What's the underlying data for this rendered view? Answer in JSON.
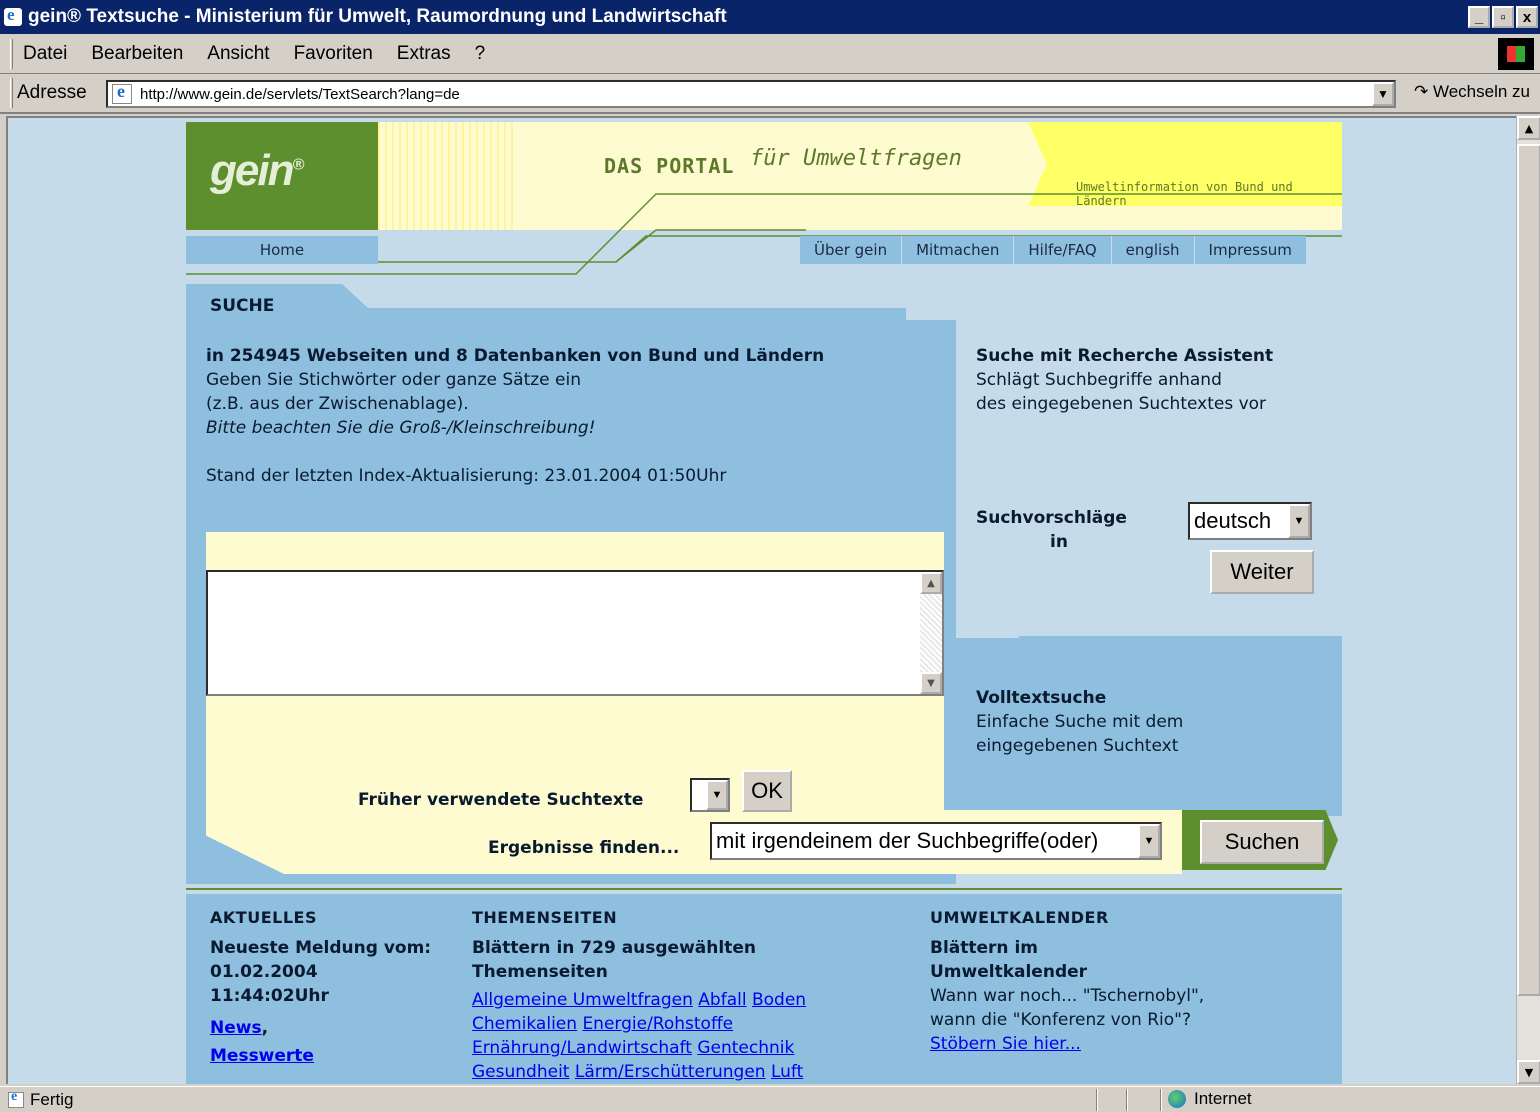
{
  "window": {
    "title": "gein® Textsuche - Ministerium für Umwelt, Raumordnung und Landwirtschaft",
    "controls": [
      "_",
      "▫",
      "x"
    ]
  },
  "menu": [
    "Datei",
    "Bearbeiten",
    "Ansicht",
    "Favoriten",
    "Extras",
    "?"
  ],
  "address": {
    "label": "Adresse",
    "url": "http://www.gein.de/servlets/TextSearch?lang=de",
    "go": "Wechseln zu"
  },
  "header": {
    "logo": "gein",
    "portal": "DAS PORTAL",
    "tagline": "für Umweltfragen",
    "info": "Umweltinformation von Bund und Ländern"
  },
  "nav": {
    "home": "Home",
    "items": [
      "Über gein",
      "Mitmachen",
      "Hilfe/FAQ",
      "english",
      "Impressum"
    ]
  },
  "search": {
    "section": "SUCHE",
    "headline": "in 254945 Webseiten und 8 Datenbanken von Bund und Ländern",
    "line1": "Geben Sie Stichwörter oder ganze Sätze ein",
    "line2": "(z.B. aus der Zwischenablage).",
    "note": "Bitte beachten Sie die Groß-/Kleinschreibung!",
    "index": "Stand der letzten Index-Aktualisierung: 23.01.2004 01:50Uhr",
    "textarea_value": "",
    "history_label": "Früher verwendete Suchtexte",
    "history_value": "",
    "ok": "OK",
    "results_label": "Ergebnisse finden...",
    "results_value": "mit irgendeinem der Suchbegriffe(oder)",
    "submit": "Suchen"
  },
  "assistant": {
    "title": "Suche mit Recherche Assistent",
    "desc1": "Schlägt Suchbegriffe anhand",
    "desc2": "des eingegebenen Suchtextes vor",
    "lang_label1": "Suchvorschläge",
    "lang_label2": "in",
    "lang_value": "deutsch",
    "next": "Weiter"
  },
  "fulltext": {
    "title": "Volltextsuche",
    "desc1": "Einfache Suche mit dem",
    "desc2": "eingegebenen Suchtext"
  },
  "aktuelles": {
    "heading": "AKTUELLES",
    "line1": "Neueste Meldung vom:",
    "line2": "01.02.2004",
    "line3": "11:44:02Uhr",
    "news": "News",
    "messwerte": "Messwerte"
  },
  "themen": {
    "heading": "THEMENSEITEN",
    "line1": "Blättern in 729 ausgewählten",
    "line2": "Themenseiten",
    "links": [
      "Allgemeine Umweltfragen",
      "Abfall",
      "Boden",
      "Chemikalien",
      "Energie/Rohstoffe",
      "Ernährung/Landwirtschaft",
      "Gentechnik",
      "Gesundheit",
      "Lärm/Erschütterungen",
      "Luft"
    ]
  },
  "kalender": {
    "heading": "UMWELTKALENDER",
    "line1": "Blättern im",
    "line2": "Umweltkalender",
    "line3": "Wann war noch... \"Tschernobyl\",",
    "line4": "wann die \"Konferenz von Rio\"?",
    "link": "Stöbern Sie hier..."
  },
  "status": {
    "text": "Fertig",
    "zone": "Internet"
  }
}
